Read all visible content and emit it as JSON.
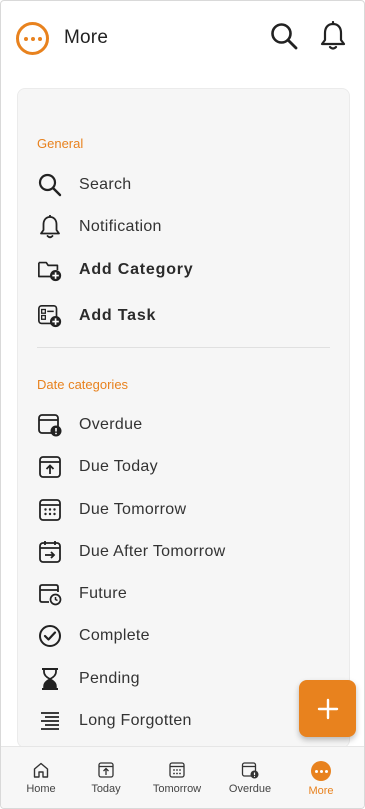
{
  "header": {
    "title": "More"
  },
  "sections": {
    "general": {
      "label": "General",
      "items": [
        {
          "label": "Search",
          "icon": "search-icon"
        },
        {
          "label": "Notification",
          "icon": "bell-icon"
        },
        {
          "label": "Add Category",
          "icon": "folder-add-icon"
        },
        {
          "label": "Add Task",
          "icon": "task-add-icon"
        }
      ]
    },
    "date_categories": {
      "label": "Date categories",
      "items": [
        {
          "label": "Overdue",
          "icon": "calendar-alert-icon"
        },
        {
          "label": "Due Today",
          "icon": "calendar-up-icon"
        },
        {
          "label": "Due Tomorrow",
          "icon": "calendar-grid-icon"
        },
        {
          "label": "Due After Tomorrow",
          "icon": "calendar-arrow-icon"
        },
        {
          "label": "Future",
          "icon": "calendar-clock-icon"
        },
        {
          "label": "Complete",
          "icon": "check-circle-icon"
        },
        {
          "label": "Pending",
          "icon": "hourglass-icon"
        },
        {
          "label": "Long Forgotten",
          "icon": "lines-icon"
        }
      ]
    }
  },
  "bottom_nav": {
    "items": [
      {
        "label": "Home"
      },
      {
        "label": "Today"
      },
      {
        "label": "Tomorrow"
      },
      {
        "label": "Overdue"
      },
      {
        "label": "More"
      }
    ],
    "active": "More"
  },
  "colors": {
    "accent": "#e8821e",
    "card": "#f6f6f6",
    "text": "#333333"
  }
}
